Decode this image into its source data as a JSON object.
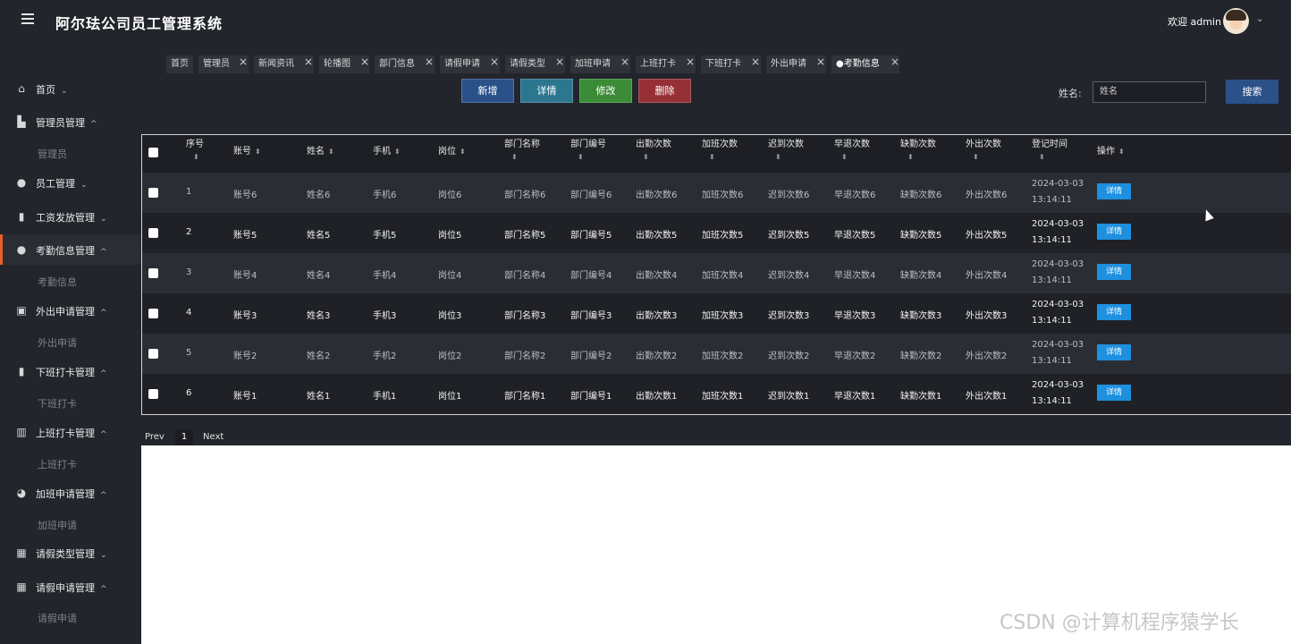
{
  "header": {
    "title": "阿尔珐公司员工管理系统",
    "welcome": "欢迎 admin",
    "menu_icon": "hamburger-icon",
    "avatar_caret": "⌄"
  },
  "sidebar": {
    "items": [
      {
        "label": "首页",
        "icon": "home-icon",
        "caret": "⌄"
      },
      {
        "label": "管理员管理",
        "icon": "building-icon",
        "caret": "^",
        "sub": "管理员"
      },
      {
        "label": "员工管理",
        "icon": "person-icon",
        "caret": "⌄"
      },
      {
        "label": "工资发放管理",
        "icon": "book-icon",
        "caret": "⌄"
      },
      {
        "label": "考勤信息管理",
        "icon": "drop-icon",
        "caret": "^",
        "sub": "考勤信息"
      },
      {
        "label": "外出申请管理",
        "icon": "id-card-icon",
        "caret": "^",
        "sub": "外出申请"
      },
      {
        "label": "下班打卡管理",
        "icon": "book-icon",
        "caret": "^",
        "sub": "下班打卡"
      },
      {
        "label": "上班打卡管理",
        "icon": "chart-icon",
        "caret": "^",
        "sub": "上班打卡"
      },
      {
        "label": "加班申请管理",
        "icon": "pie-icon",
        "caret": "^",
        "sub": "加班申请"
      },
      {
        "label": "请假类型管理",
        "icon": "grid-icon",
        "caret": "⌄"
      },
      {
        "label": "请假申请管理",
        "icon": "grid-icon",
        "caret": "^",
        "sub": "请假申请"
      }
    ]
  },
  "tabs": [
    {
      "label": "首页",
      "closable": false
    },
    {
      "label": "管理员",
      "closable": true
    },
    {
      "label": "新闻资讯",
      "closable": true
    },
    {
      "label": "轮播图",
      "closable": true
    },
    {
      "label": "部门信息",
      "closable": true
    },
    {
      "label": "请假申请",
      "closable": true
    },
    {
      "label": "请假类型",
      "closable": true
    },
    {
      "label": "加班申请",
      "closable": true
    },
    {
      "label": "上班打卡",
      "closable": true
    },
    {
      "label": "下班打卡",
      "closable": true
    },
    {
      "label": "外出申请",
      "closable": true
    },
    {
      "label": "●考勤信息",
      "closable": true,
      "current": true
    }
  ],
  "toolbar": {
    "add_label": "新增",
    "detail_label": "详情",
    "edit_label": "修改",
    "delete_label": "删除",
    "search_label": "姓名:",
    "search_placeholder": "姓名",
    "search_button": "搜索"
  },
  "table": {
    "headers": [
      "序号",
      "账号",
      "姓名",
      "手机",
      "岗位",
      "部门名称",
      "部门编号",
      "出勤次数",
      "加班次数",
      "迟到次数",
      "早退次数",
      "缺勤次数",
      "外出次数",
      "登记时间",
      "操作"
    ],
    "rows": [
      [
        "1",
        "账号6",
        "姓名6",
        "手机6",
        "岗位6",
        "部门名称6",
        "部门编号6",
        "出勤次数6",
        "加班次数6",
        "迟到次数6",
        "早退次数6",
        "缺勤次数6",
        "外出次数6",
        "2024-03-03",
        "13:14:11"
      ],
      [
        "2",
        "账号5",
        "姓名5",
        "手机5",
        "岗位5",
        "部门名称5",
        "部门编号5",
        "出勤次数5",
        "加班次数5",
        "迟到次数5",
        "早退次数5",
        "缺勤次数5",
        "外出次数5",
        "2024-03-03",
        "13:14:11"
      ],
      [
        "3",
        "账号4",
        "姓名4",
        "手机4",
        "岗位4",
        "部门名称4",
        "部门编号4",
        "出勤次数4",
        "加班次数4",
        "迟到次数4",
        "早退次数4",
        "缺勤次数4",
        "外出次数4",
        "2024-03-03",
        "13:14:11"
      ],
      [
        "4",
        "账号3",
        "姓名3",
        "手机3",
        "岗位3",
        "部门名称3",
        "部门编号3",
        "出勤次数3",
        "加班次数3",
        "迟到次数3",
        "早退次数3",
        "缺勤次数3",
        "外出次数3",
        "2024-03-03",
        "13:14:11"
      ],
      [
        "5",
        "账号2",
        "姓名2",
        "手机2",
        "岗位2",
        "部门名称2",
        "部门编号2",
        "出勤次数2",
        "加班次数2",
        "迟到次数2",
        "早退次数2",
        "缺勤次数2",
        "外出次数2",
        "2024-03-03",
        "13:14:11"
      ],
      [
        "6",
        "账号1",
        "姓名1",
        "手机1",
        "岗位1",
        "部门名称1",
        "部门编号1",
        "出勤次数1",
        "加班次数1",
        "迟到次数1",
        "早退次数1",
        "缺勤次数1",
        "外出次数1",
        "2024-03-03",
        "13:14:11"
      ]
    ],
    "row_button": "详情"
  },
  "pager": {
    "prev": "Prev",
    "current": "1",
    "next": "Next"
  },
  "watermark": "CSDN @计算机程序猿学长",
  "colors": {
    "bg_dark": "#23252c",
    "accent_orange": "#e6612a",
    "btn_blue": "#2b5189",
    "btn_teal": "#2d7690",
    "btn_green": "#3b8b37",
    "btn_red": "#963036",
    "detail_blue": "#1e90e0"
  }
}
